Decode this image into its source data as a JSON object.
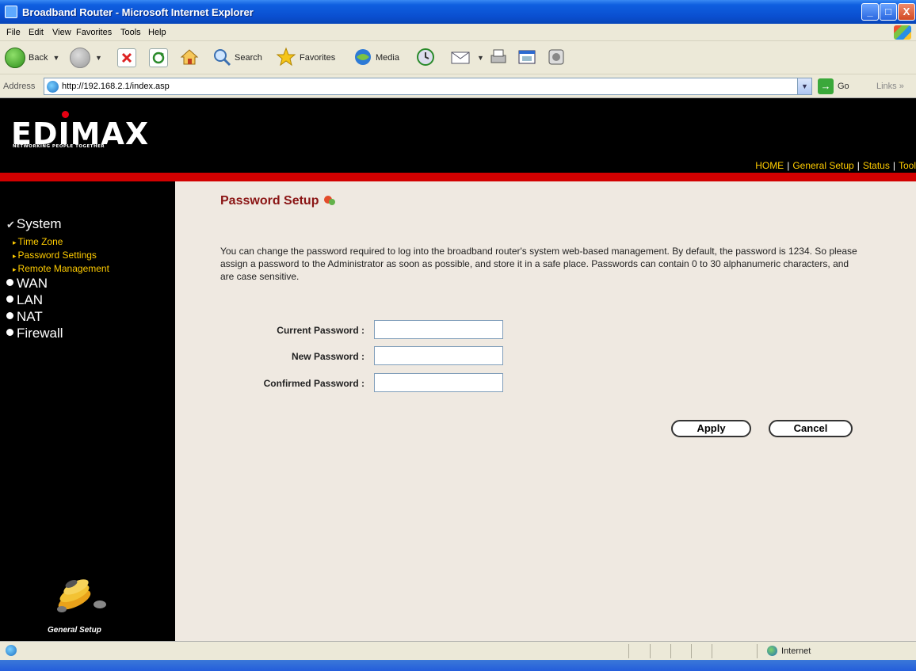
{
  "window": {
    "title": "Broadband Router - Microsoft Internet Explorer",
    "controls": [
      "_",
      "□",
      "X"
    ]
  },
  "menubar": {
    "items": [
      "File",
      "Edit",
      "View",
      "Favorites",
      "Tools",
      "Help"
    ]
  },
  "toolbar": {
    "back_label": "Back",
    "search_label": "Search",
    "favorites_label": "Favorites",
    "media_label": "Media"
  },
  "address": {
    "label": "Address",
    "url": "http://192.168.2.1/index.asp",
    "go_label": "Go",
    "links_label": "Links »"
  },
  "header": {
    "logo": "EDIMAX",
    "tagline": "NETWORKING PEOPLE TOGETHER",
    "nav": [
      "HOME",
      "General Setup",
      "Status",
      "Tool"
    ]
  },
  "sidebar": {
    "system_label": "System",
    "system_items": [
      "Time Zone",
      "Password Settings",
      "Remote Management"
    ],
    "top_items": [
      "WAN",
      "LAN",
      "NAT",
      "Firewall"
    ],
    "footer_label": "General Setup"
  },
  "content": {
    "title": "Password Setup",
    "description": "You can change the password required to log into the broadband router's system web-based management. By default, the password is 1234. So please assign a password to the Administrator as soon as possible, and store it in a safe place. Passwords can contain 0 to 30 alphanumeric characters, and are case sensitive.",
    "fields": {
      "current_label": "Current Password :",
      "new_label": "New Password :",
      "confirm_label": "Confirmed Password :",
      "current_value": "",
      "new_value": "",
      "confirm_value": ""
    },
    "apply_label": "Apply",
    "cancel_label": "Cancel"
  },
  "statusbar": {
    "zone": "Internet"
  },
  "colors": {
    "titlebar": "#0a4fd0",
    "header_bg": "#000000",
    "accent_red": "#d20000",
    "nav_yellow": "#ffcc00",
    "content_bg": "#efe9e1",
    "title_red": "#8a1414"
  }
}
